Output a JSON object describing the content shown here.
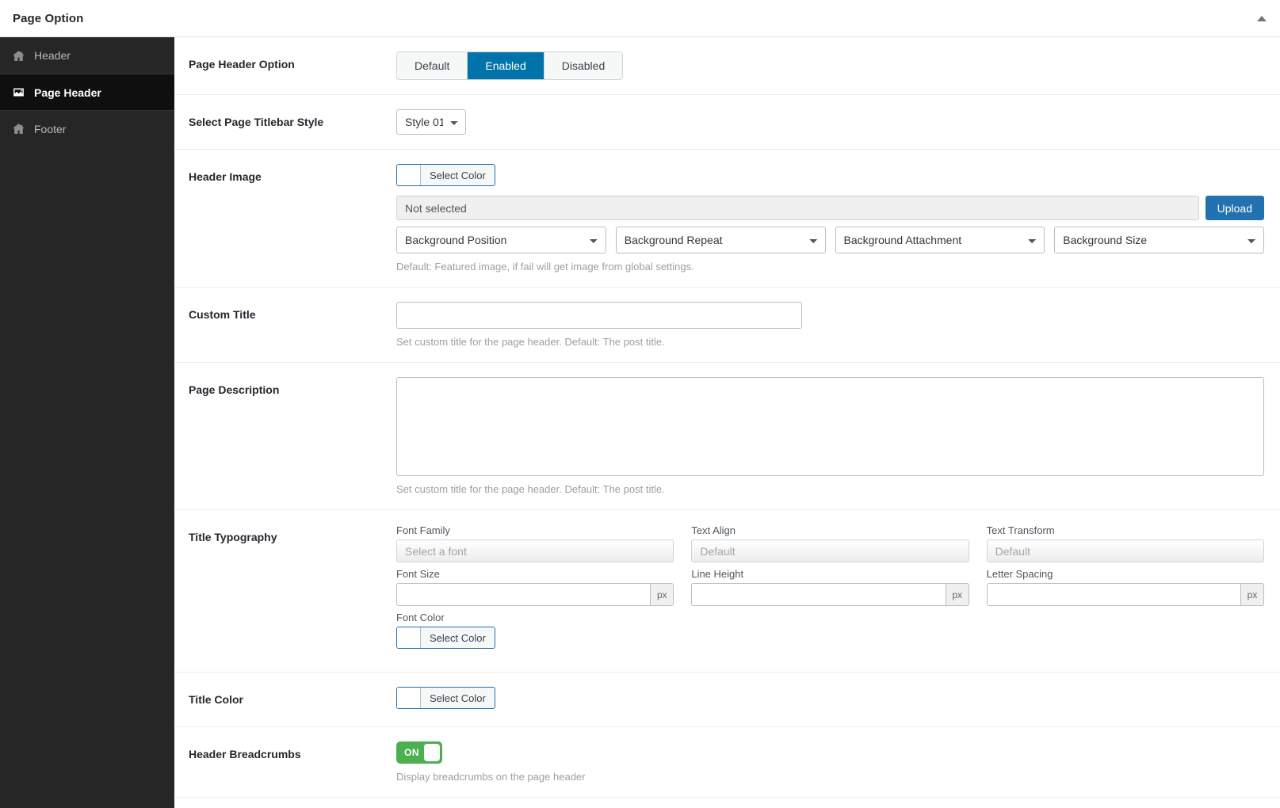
{
  "topbar": {
    "title": "Page Option",
    "collapse_icon": "caret-up-icon"
  },
  "sidebar": {
    "items": [
      {
        "label": "Header",
        "icon": "home-icon",
        "active": false
      },
      {
        "label": "Page Header",
        "icon": "image-icon",
        "active": true
      },
      {
        "label": "Footer",
        "icon": "home-icon",
        "active": false
      }
    ]
  },
  "colors": {
    "accent_blue": "#0073aa",
    "upload_blue": "#2271b1",
    "toggle_green": "#4caf50",
    "sidebar_bg": "#262626",
    "sidebar_active_bg": "#0f0f0f"
  },
  "rows": {
    "page_header_option": {
      "label": "Page Header Option",
      "buttons": [
        {
          "label": "Default",
          "active": false
        },
        {
          "label": "Enabled",
          "active": true
        },
        {
          "label": "Disabled",
          "active": false
        }
      ]
    },
    "titlebar_style": {
      "label": "Select Page Titlebar Style",
      "value": "Style 01"
    },
    "header_image": {
      "label": "Header Image",
      "color_button": "Select Color",
      "file_value": "Not selected",
      "upload_label": "Upload",
      "bg_position": "Background Position",
      "bg_repeat": "Background Repeat",
      "bg_attachment": "Background Attachment",
      "bg_size": "Background Size",
      "help": "Default: Featured image, if fail will get image from global settings."
    },
    "custom_title": {
      "label": "Custom Title",
      "value": "",
      "help": "Set custom title for the page header. Default: The post title."
    },
    "page_description": {
      "label": "Page Description",
      "value": "",
      "help": "Set custom title for the page header. Default: The post title."
    },
    "title_typography": {
      "label": "Title Typography",
      "font_family_label": "Font Family",
      "font_family_value": "Select a font",
      "text_align_label": "Text Align",
      "text_align_value": "Default",
      "text_transform_label": "Text Transform",
      "text_transform_value": "Default",
      "font_size_label": "Font Size",
      "font_size_value": "",
      "font_size_unit": "px",
      "line_height_label": "Line Height",
      "line_height_value": "",
      "line_height_unit": "px",
      "letter_spacing_label": "Letter Spacing",
      "letter_spacing_value": "",
      "letter_spacing_unit": "px",
      "font_color_label": "Font Color",
      "font_color_button": "Select Color"
    },
    "title_color": {
      "label": "Title Color",
      "color_button": "Select Color"
    },
    "header_breadcrumbs": {
      "label": "Header Breadcrumbs",
      "toggle_state": "ON",
      "help": "Display breadcrumbs on the page header"
    }
  }
}
